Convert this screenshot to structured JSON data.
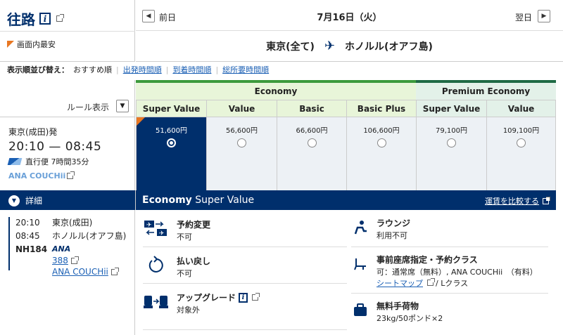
{
  "header": {
    "title": "往路",
    "cheapest_label": "画面内最安"
  },
  "date_nav": {
    "prev_label": "前日",
    "date": "7月16日（火）",
    "next_label": "翌日"
  },
  "route": {
    "origin": "東京(全て)",
    "destination": "ホノルル(オアフ島)"
  },
  "sort": {
    "label": "表示順並び替え：",
    "options": [
      "おすすめ順",
      "出発時間順",
      "到着時間順",
      "総所要時間順"
    ]
  },
  "rules": {
    "label": "ルール表示"
  },
  "cabins": {
    "economy": "Economy",
    "premium": "Premium Economy"
  },
  "fare_headers": [
    "Super Value",
    "Value",
    "Basic",
    "Basic Plus",
    "Super Value",
    "Value"
  ],
  "fares": [
    "51,600円",
    "56,600円",
    "66,600円",
    "106,600円",
    "79,100円",
    "109,100円"
  ],
  "flight": {
    "origin": "東京(成田)発",
    "times": "20:10 — 08:45",
    "direct": "直行便 7時間35分",
    "brand": "ANA COUCHii"
  },
  "detail_bar": {
    "toggle_label": "詳細",
    "title_bold": "Economy",
    "title_rest": " Super Value",
    "compare_link": "運賃を比較する"
  },
  "segment": {
    "dep_time": "20:10",
    "dep_place": "東京(成田)",
    "arr_time": "08:45",
    "arr_place": "ホノルル(オアフ島)",
    "flight_no": "NH184",
    "airline_mark": "ANA",
    "aircraft": "388",
    "brand": "ANA COUCHii"
  },
  "conditions": {
    "change_title": "予約変更",
    "change_value": "不可",
    "refund_title": "払い戻し",
    "refund_value": "不可",
    "upgrade_title": "アップグレード",
    "upgrade_value": "対象外",
    "lounge_title": "ラウンジ",
    "lounge_value": "利用不可",
    "seat_title": "事前座席指定・予約クラス",
    "seat_value": "可：通常席（無料）, ANA COUCHii　（有料）",
    "seat_map_link": "シートマップ",
    "seat_class": "/ Lクラス",
    "baggage_title": "無料手荷物",
    "baggage_value": "23kg/50ポンド×2"
  }
}
